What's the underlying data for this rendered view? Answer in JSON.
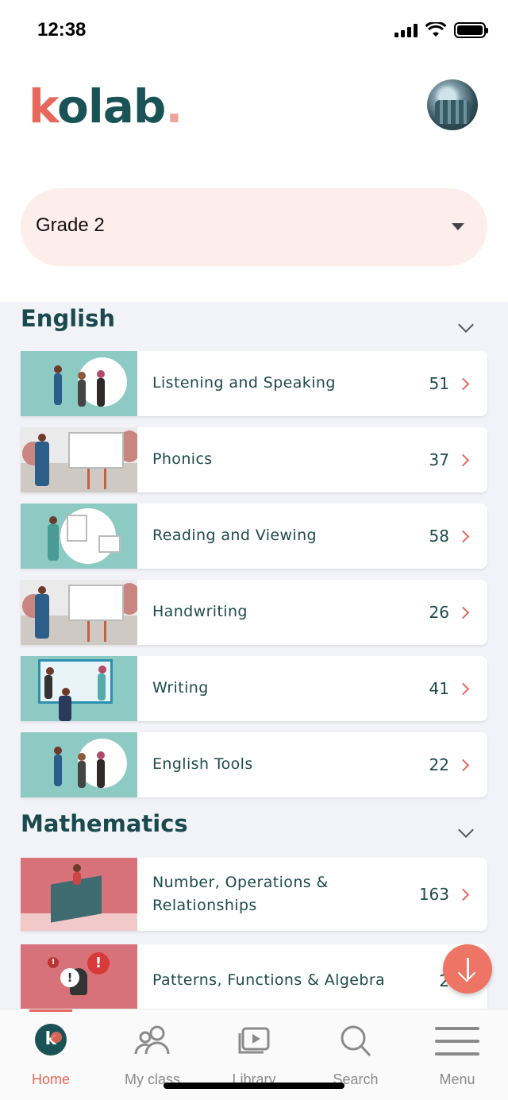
{
  "status": {
    "time": "12:38"
  },
  "header": {
    "logo_text": "kolab",
    "logo_letters": [
      "k",
      "olab",
      "."
    ]
  },
  "grade": {
    "selected": "Grade 2"
  },
  "sections": [
    {
      "title": "English",
      "items": [
        {
          "label": "Listening and Speaking",
          "count": "51"
        },
        {
          "label": "Phonics",
          "count": "37"
        },
        {
          "label": "Reading and Viewing",
          "count": "58"
        },
        {
          "label": "Handwriting",
          "count": "26"
        },
        {
          "label": "Writing",
          "count": "41"
        },
        {
          "label": "English Tools",
          "count": "22"
        }
      ]
    },
    {
      "title": "Mathematics",
      "items": [
        {
          "label": "Number, Operations & Relationships",
          "count": "163"
        },
        {
          "label": "Patterns, Functions & Algebra",
          "count": "2"
        }
      ]
    }
  ],
  "tabs": [
    {
      "label": "Home",
      "icon": "home-logo-icon",
      "active": true
    },
    {
      "label": "My class",
      "icon": "users-icon",
      "active": false
    },
    {
      "label": "Library",
      "icon": "library-play-icon",
      "active": false
    },
    {
      "label": "Search",
      "icon": "search-icon",
      "active": false
    },
    {
      "label": "Menu",
      "icon": "menu-icon",
      "active": false
    }
  ],
  "colors": {
    "accent": "#e7685a",
    "brand": "#1a5356",
    "select_bg": "#fdeeeb",
    "list_bg": "#f2f3f8"
  }
}
